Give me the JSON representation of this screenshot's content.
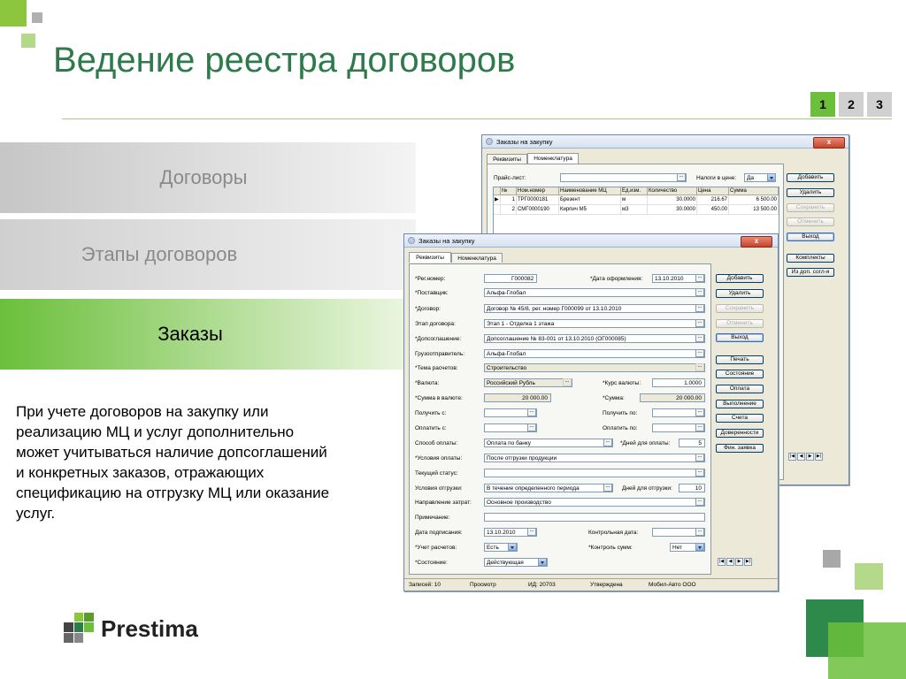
{
  "slide": {
    "title": "Ведение реестра договоров",
    "pages": [
      "1",
      "2",
      "3"
    ],
    "nav": [
      "Договоры",
      "Этапы договоров",
      "Заказы"
    ],
    "description": "При учете договоров на закупку или реализацию МЦ и услуг дополнительно может учитываться наличие допсоглашений и конкретных заказов, отражающих спецификацию на отгрузку МЦ или оказание услуг.",
    "logo": "Prestima"
  },
  "colors": {
    "brand_green": "#2d7a4a",
    "accent_green": "#8cc63f",
    "active_nav": "#6bbf3b"
  },
  "back_window": {
    "title": "Заказы на закупку",
    "close": "x",
    "tabs": [
      "Реквизиты",
      "Номенклатура"
    ],
    "price_label": "Прайс-лист:",
    "tax_label": "Налоги в цене:",
    "tax_value": "Да",
    "columns": [
      "№",
      "Ном.номер",
      "Наименование МЦ",
      "Ед.изм.",
      "Количество",
      "Цена",
      "Сумма"
    ],
    "rows": [
      [
        "1",
        "ТРГ0000181",
        "Брезент",
        "м",
        "30.0000",
        "216.67",
        "6 500.00"
      ],
      [
        "2",
        "СМГ0000190",
        "Кирпич М5",
        "м3",
        "30.0000",
        "450.00",
        "13 500.00"
      ]
    ],
    "buttons": [
      "Добавить",
      "Удалить",
      "Сохранить",
      "Отменить",
      "Выход",
      "Комплекты",
      "Из доп. согл-я"
    ]
  },
  "front_window": {
    "title": "Заказы на закупку",
    "close": "x",
    "tabs": [
      "Реквизиты",
      "Номенклатура"
    ],
    "labels": {
      "reg": "*Рег.номер:",
      "date": "*Дата оформления:",
      "supplier": "*Поставщик:",
      "contract": "*Договор:",
      "stage": "Этап договора:",
      "addendum": "*Допсоглашение:",
      "shipper": "Грузоотправитель:",
      "theme": "*Тема расчетов:",
      "currency": "*Валюта:",
      "rate": "*Курс валюты:",
      "sum_cur": "*Сумма в валюте:",
      "sum": "*Сумма:",
      "recv_from": "Получить с:",
      "recv_to": "Получить по:",
      "pay_from": "Оплатить с:",
      "pay_to": "Оплатить по:",
      "pay_method": "Способ оплаты:",
      "pay_days": "*Дней для оплаты:",
      "pay_terms": "*Условия оплаты:",
      "cur_status": "Текущий статус:",
      "ship_terms": "Условия отгрузки:",
      "ship_days": "Дней для отгрузки:",
      "cost_dir": "Направление затрат:",
      "note": "Примечание:",
      "sign_date": "Дата подписания:",
      "ctrl_date": "Контрольная дата:",
      "settle": "*Учет расчетов:",
      "sum_ctrl": "*Контроль сумм:",
      "state": "*Состояние:"
    },
    "values": {
      "reg": "Г000082",
      "date": "13.10.2010",
      "supplier": "Альфа-Глобал",
      "contract": "Договор № 45/8, рег. номер Г000099 от 13.10.2010",
      "stage": "Этап 1 - Отделка 1 этажа",
      "addendum": "Допсоглашение № 83-001 от 13.10.2010 (ОГ000085)",
      "shipper": "Альфа-Глобал",
      "theme": "Строительство",
      "currency": "Российский Рубль",
      "rate": "1.0000",
      "sum_cur": "20 000.00",
      "sum": "20 000.00",
      "pay_method": "Оплата по банку",
      "pay_days": "5",
      "pay_terms": "После отгрузки продукции",
      "ship_terms": "В течение определенного периода",
      "ship_days": "10",
      "cost_dir": "Основное производство",
      "sign_date": "13.10.2010",
      "settle": "Есть",
      "sum_ctrl": "Нет",
      "state": "Действующая"
    },
    "buttons": [
      "Добавить",
      "Удалить",
      "Сохранить",
      "Отменить",
      "Выход",
      "Печать",
      "Состояние",
      "Оплата",
      "Выполнение",
      "Счета",
      "Доверенности",
      "Фин. заявка"
    ],
    "status": [
      "Записей: 10",
      "Просмотр",
      "ИД: 20703",
      "Утверждена",
      "Мобил-Авто ООО"
    ]
  }
}
